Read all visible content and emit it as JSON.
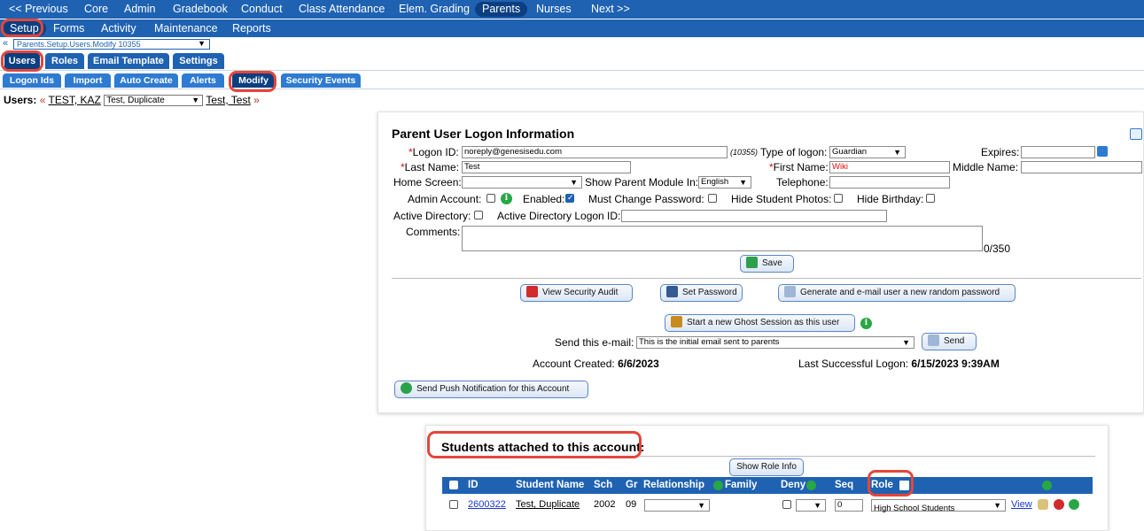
{
  "nav1": [
    {
      "label": "<< Previous"
    },
    {
      "label": "Core"
    },
    {
      "label": "Admin"
    },
    {
      "label": "Gradebook"
    },
    {
      "label": "Conduct"
    },
    {
      "label": "Class Attendance"
    },
    {
      "label": "Elem. Grading"
    },
    {
      "label": "Parents"
    },
    {
      "label": "Nurses"
    },
    {
      "label": "Next >>"
    }
  ],
  "nav2": [
    {
      "label": "Setup"
    },
    {
      "label": "Forms"
    },
    {
      "label": "Activity"
    },
    {
      "label": "Maintenance"
    },
    {
      "label": "Reports"
    }
  ],
  "breadcrumb": {
    "arrow": "«",
    "value": "Parents.Setup.Users.Modify 10355"
  },
  "tabs1": [
    {
      "label": "Users"
    },
    {
      "label": "Roles"
    },
    {
      "label": "Email Template"
    },
    {
      "label": "Settings"
    }
  ],
  "tabs2": [
    {
      "label": "Logon Ids"
    },
    {
      "label": "Import"
    },
    {
      "label": "Auto Create"
    },
    {
      "label": "Alerts"
    },
    {
      "label": "Modify"
    },
    {
      "label": "Security Events"
    }
  ],
  "users_line": {
    "label": "Users:",
    "prev": "«",
    "prev_user": "TEST, KAZ",
    "selected": "Test, Duplicate",
    "next_user": "Test, Test",
    "next": "»"
  },
  "form": {
    "title": "Parent User Logon Information",
    "logon_id_label": "Logon ID:",
    "logon_id_value": "noreply@genesisedu.com",
    "logon_id_note": "(10355)",
    "type_label": "Type of logon:",
    "type_value": "Guardian",
    "expires_label": "Expires:",
    "expires_value": "",
    "last_name_label": "Last Name:",
    "last_name_value": "Test",
    "first_name_label": "First Name:",
    "first_name_value": "Wiki",
    "middle_name_label": "Middle Name:",
    "middle_name_value": "",
    "home_screen_label": "Home Screen:",
    "home_screen_value": "",
    "module_lang_label": "Show Parent Module In:",
    "module_lang_value": "English",
    "telephone_label": "Telephone:",
    "telephone_value": "",
    "admin_label": "Admin Account:",
    "admin_checked": false,
    "enabled_label": "Enabled:",
    "enabled_checked": true,
    "must_change_label": "Must Change Password:",
    "must_change_checked": false,
    "hide_photos_label": "Hide Student Photos:",
    "hide_photos_checked": false,
    "hide_bday_label": "Hide Birthday:",
    "hide_bday_checked": false,
    "ad_label": "Active Directory:",
    "ad_checked": false,
    "ad_logon_label": "Active Directory Logon ID:",
    "ad_logon_value": "",
    "comments_label": "Comments:",
    "comments_value": "",
    "comments_count": "0/350",
    "save_label": "Save"
  },
  "actions": {
    "view_audit": "View Security Audit",
    "set_password": "Set Password",
    "gen_password": "Generate and e-mail user a new random password",
    "ghost_session": "Start a new Ghost Session as this user",
    "send_email_label": "Send this e-mail:",
    "send_email_value": "This is the initial email sent to parents",
    "send_label": "Send",
    "created_label": "Account Created:",
    "created_value": "6/6/2023",
    "last_logon_label": "Last Successful Logon:",
    "last_logon_value": "6/15/2023 9:39AM",
    "push_label": "Send Push Notification for this Account"
  },
  "students": {
    "title": "Students attached to this account:",
    "role_info_label": "Show Role Info",
    "columns": [
      "ID",
      "Student Name",
      "Sch",
      "Gr",
      "Relationship",
      "Family",
      "Deny",
      "Seq",
      "Role"
    ],
    "rows": [
      {
        "id": "2600322",
        "name": "Test, Duplicate",
        "sch": "2002",
        "gr": "09",
        "relationship": "",
        "family": "",
        "deny_checked": false,
        "deny_value": "",
        "seq": "0",
        "role": "High School Students",
        "view": "View"
      }
    ]
  },
  "colors": {
    "nav": "#1f62b2",
    "nav_active": "#0c3f80",
    "highlight": "#e3463c",
    "info": "#28a745"
  }
}
